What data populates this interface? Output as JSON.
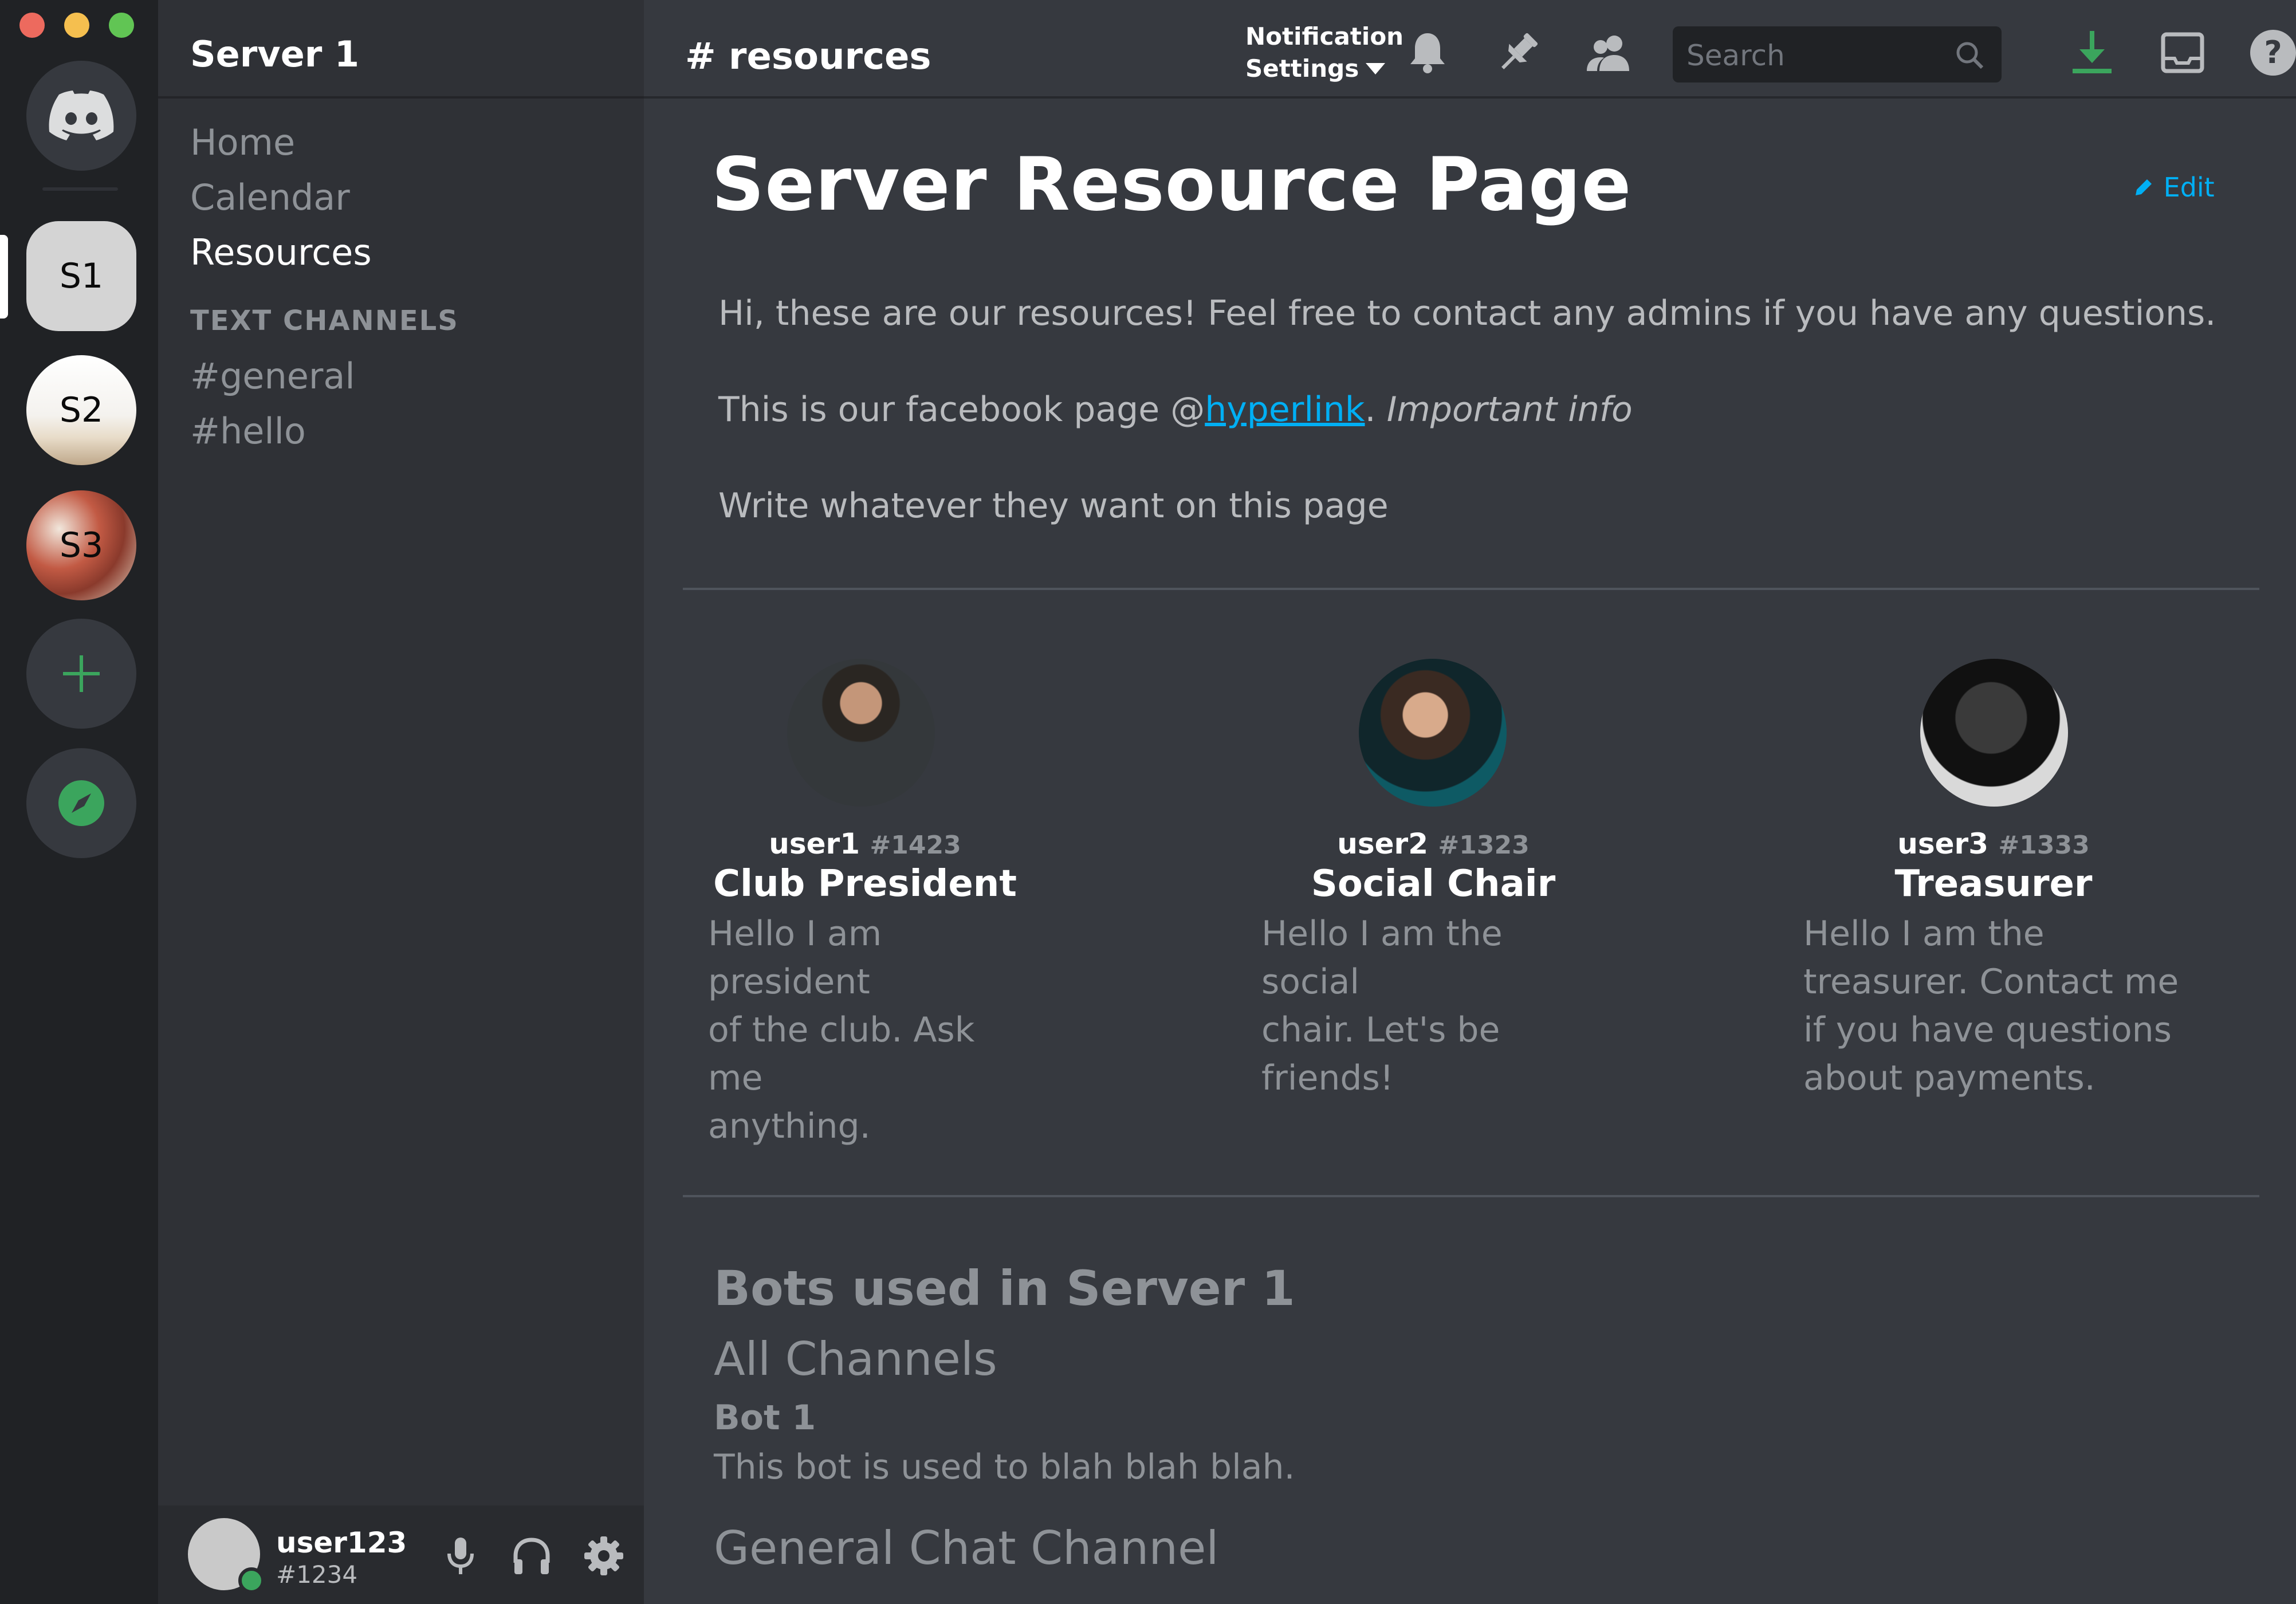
{
  "window": {
    "traffic_lights": [
      "#ed6a5e",
      "#f5bf4f",
      "#61c554"
    ]
  },
  "servers": {
    "home_icon": "discord-logo-icon",
    "items": [
      {
        "label": "S1",
        "active": true
      },
      {
        "label": "S2",
        "active": false
      },
      {
        "label": "S3",
        "active": false
      }
    ],
    "add_icon": "plus-icon",
    "explore_icon": "compass-icon",
    "accent": "#3ba55d"
  },
  "sidebar": {
    "server_name": "Server 1",
    "nav": [
      {
        "label": "Home",
        "active": false
      },
      {
        "label": "Calendar",
        "active": false
      },
      {
        "label": "Resources",
        "active": true
      }
    ],
    "category": "TEXT CHANNELS",
    "channels": [
      "#general",
      "#hello"
    ]
  },
  "user_panel": {
    "username": "user123",
    "discriminator": "#1234",
    "status": "online",
    "icons": [
      "microphone-icon",
      "headphones-icon",
      "gear-icon"
    ]
  },
  "topbar": {
    "channel": "# resources",
    "notif_line1": "Notification",
    "notif_line2": "Settings",
    "search_placeholder": "Search",
    "icons": [
      "bell-icon",
      "pin-icon",
      "members-icon",
      "search-icon",
      "download-icon",
      "inbox-icon",
      "help-icon"
    ]
  },
  "page": {
    "title": "Server Resource Page",
    "edit_label": "Edit",
    "intro": "Hi, these are our resources! Feel free to contact any admins if you have any questions.",
    "fb_prefix": "This is our facebook page @",
    "fb_link": "hyperlink",
    "fb_suffix": ". ",
    "fb_important": "Important info",
    "write_line": "Write whatever they want on this page"
  },
  "admins": [
    {
      "username": "user1",
      "disc": "#1423",
      "role": "Club President",
      "bio": [
        "Hello I am president",
        "of the club. Ask me",
        "anything."
      ]
    },
    {
      "username": "user2",
      "disc": "#1323",
      "role": "Social Chair",
      "bio": [
        "Hello I am the social",
        "chair. Let's be friends!"
      ]
    },
    {
      "username": "user3",
      "disc": "#1333",
      "role": "Treasurer",
      "bio": [
        "Hello I am the",
        "treasurer. Contact me",
        "if you have questions",
        "about payments."
      ]
    }
  ],
  "bots": {
    "heading": "Bots used in Server 1",
    "section1": "All Channels",
    "bot1_name": "Bot 1",
    "bot1_desc": "This bot is used to blah blah blah.",
    "section2": "General Chat Channel"
  }
}
